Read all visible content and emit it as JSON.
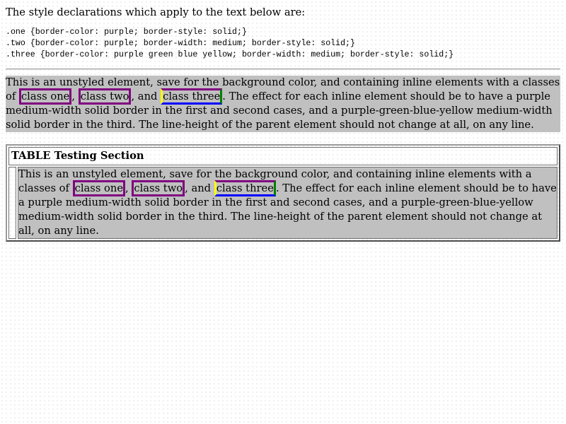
{
  "intro": "The style declarations which apply to the text below are:",
  "css_rules": [
    ".one {border-color: purple; border-style: solid;}",
    ".two {border-color: purple; border-width: medium; border-style: solid;}",
    ".three {border-color: purple green blue yellow; border-width: medium; border-style: solid;}"
  ],
  "paragraph": {
    "before": "This is an unstyled element, save for the background color, and containing inline elements with a classes of ",
    "class_one": "class one",
    "sep1": ", ",
    "class_two": "class two",
    "sep2": ", and ",
    "class_three": "class three",
    "after": ". The effect for each inline element should be to have a purple medium-width solid border in the first and second cases, and a purple-green-blue-yellow medium-width solid border in the third. The line-height of the parent element should not change at all, on any line."
  },
  "table": {
    "heading": "TABLE Testing Section"
  },
  "colors": {
    "page_background": "#ffffff",
    "paragraph_background": "#c0c0c0",
    "border_purple": "purple",
    "border_green": "green",
    "border_blue": "blue",
    "border_yellow": "yellow"
  }
}
